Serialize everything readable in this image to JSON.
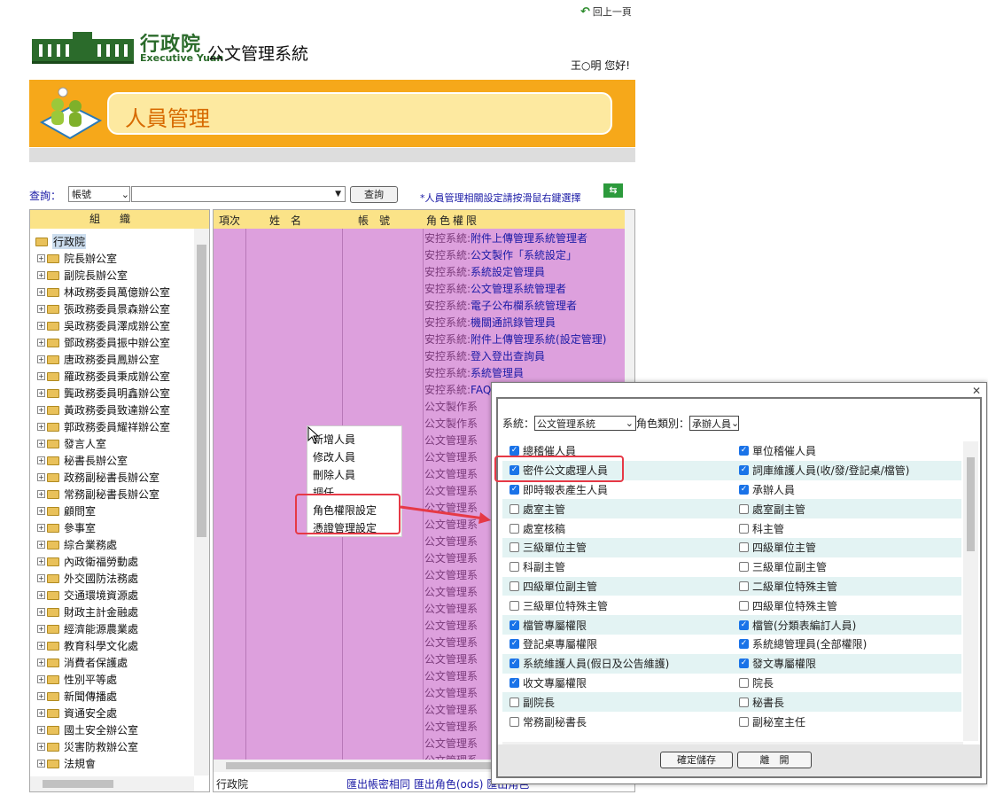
{
  "header": {
    "back_label": "回上一頁",
    "logo_cn": "行政院",
    "logo_en": "Executive Yuan",
    "system_name": "公文管理系統",
    "greeting": "王○明 您好!",
    "page_title": "人員管理"
  },
  "search": {
    "label": "查詢：",
    "field": "帳號",
    "button": "查詢",
    "hint": "*人員管理相關設定請按滑鼠右鍵選擇"
  },
  "org_panel": {
    "header": "組織",
    "root": "行政院",
    "items": [
      "院長辦公室",
      "副院長辦公室",
      "林政務委員萬億辦公室",
      "張政務委員景森辦公室",
      "吳政務委員澤成辦公室",
      "鄧政務委員振中辦公室",
      "唐政務委員鳳辦公室",
      "羅政務委員秉成辦公室",
      "龔政務委員明鑫辦公室",
      "黃政務委員致達辦公室",
      "郭政務委員耀祥辦公室",
      "發言人室",
      "秘書長辦公室",
      "政務副秘書長辦公室",
      "常務副秘書長辦公室",
      "顧問室",
      "參事室",
      "綜合業務處",
      "內政衛福勞動處",
      "外交國防法務處",
      "交通環境資源處",
      "財政主計金融處",
      "經濟能源農業處",
      "教育科學文化處",
      "消費者保護處",
      "性別平等處",
      "新聞傳播處",
      "資通安全處",
      "國土安全辦公室",
      "災害防救辦公室",
      "法規會"
    ]
  },
  "list": {
    "headers": {
      "no": "項次",
      "name": "姓　名",
      "account": "帳　號",
      "roles": "角色權限"
    },
    "roles": [
      {
        "sys": "安控系統:",
        "role": "附件上傳管理系統管理者"
      },
      {
        "sys": "安控系統:",
        "role": "公文製作「系統設定」"
      },
      {
        "sys": "安控系統:",
        "role": "系統設定管理員"
      },
      {
        "sys": "安控系統:",
        "role": "公文管理系統管理者"
      },
      {
        "sys": "安控系統:",
        "role": "電子公布欄系統管理者"
      },
      {
        "sys": "安控系統:",
        "role": "機關通訊錄管理員"
      },
      {
        "sys": "安控系統:",
        "role": "附件上傳管理系統(設定管理)"
      },
      {
        "sys": "安控系統:",
        "role": "登入登出查詢員"
      },
      {
        "sys": "安控系統:",
        "role": "系統管理員"
      },
      {
        "sys": "安控系統:",
        "role": "FAQ"
      },
      {
        "sys": "公文製作系",
        "role": ""
      },
      {
        "sys": "公文製作系",
        "role": ""
      },
      {
        "sys": "公文管理系",
        "role": ""
      },
      {
        "sys": "公文管理系",
        "role": ""
      },
      {
        "sys": "公文管理系",
        "role": ""
      },
      {
        "sys": "公文管理系",
        "role": ""
      },
      {
        "sys": "公文管理系",
        "role": ""
      },
      {
        "sys": "公文管理系",
        "role": ""
      },
      {
        "sys": "公文管理系",
        "role": ""
      },
      {
        "sys": "公文管理系",
        "role": ""
      },
      {
        "sys": "公文管理系",
        "role": ""
      },
      {
        "sys": "公文管理系",
        "role": ""
      },
      {
        "sys": "公文管理系",
        "role": ""
      },
      {
        "sys": "公文管理系",
        "role": ""
      },
      {
        "sys": "公文管理系",
        "role": ""
      },
      {
        "sys": "公文管理系",
        "role": ""
      },
      {
        "sys": "公文管理系",
        "role": ""
      },
      {
        "sys": "公文管理系",
        "role": ""
      },
      {
        "sys": "公文管理系",
        "role": ""
      },
      {
        "sys": "公文管理系",
        "role": ""
      },
      {
        "sys": "公文管理系",
        "role": ""
      },
      {
        "sys": "公文管理系",
        "role": ""
      }
    ],
    "footer_org": "行政院",
    "footer_export": "匯出帳密相同 匯出角色(ods) 匯出角色"
  },
  "context_menu": {
    "items": [
      "新增人員",
      "修改人員",
      "刪除人員",
      "調任",
      "角色權限設定",
      "憑證管理設定"
    ]
  },
  "dialog": {
    "system_label": "系統：",
    "system_value": "公文管理系統",
    "role_type_label": "角色類別：",
    "role_type_value": "承辦人員",
    "rows": [
      [
        {
          "label": "總稽催人員",
          "checked": true
        },
        {
          "label": "單位稽催人員",
          "checked": true
        }
      ],
      [
        {
          "label": "密件公文處理人員",
          "checked": true
        },
        {
          "label": "詞庫維護人員(收/發/登記桌/檔管)",
          "checked": true
        }
      ],
      [
        {
          "label": "即時報表產生人員",
          "checked": true
        },
        {
          "label": "承辦人員",
          "checked": true
        }
      ],
      [
        {
          "label": "處室主管",
          "checked": false
        },
        {
          "label": "處室副主管",
          "checked": false
        }
      ],
      [
        {
          "label": "處室核稿",
          "checked": false
        },
        {
          "label": "科主管",
          "checked": false
        }
      ],
      [
        {
          "label": "三級單位主管",
          "checked": false
        },
        {
          "label": "四級單位主管",
          "checked": false
        }
      ],
      [
        {
          "label": "科副主管",
          "checked": false
        },
        {
          "label": "三級單位副主管",
          "checked": false
        }
      ],
      [
        {
          "label": "四級單位副主管",
          "checked": false
        },
        {
          "label": "二級單位特殊主管",
          "checked": false
        }
      ],
      [
        {
          "label": "三級單位特殊主管",
          "checked": false
        },
        {
          "label": "四級單位特殊主管",
          "checked": false
        }
      ],
      [
        {
          "label": "檔管專屬權限",
          "checked": true
        },
        {
          "label": "檔管(分類表編訂人員)",
          "checked": true
        }
      ],
      [
        {
          "label": "登記桌專屬權限",
          "checked": true
        },
        {
          "label": "系統總管理員(全部權限)",
          "checked": true
        }
      ],
      [
        {
          "label": "系統維護人員(假日及公告維護)",
          "checked": true
        },
        {
          "label": "發文專屬權限",
          "checked": true
        }
      ],
      [
        {
          "label": "收文專屬權限",
          "checked": true
        },
        {
          "label": "院長",
          "checked": false
        }
      ],
      [
        {
          "label": "副院長",
          "checked": false
        },
        {
          "label": "秘書長",
          "checked": false
        }
      ],
      [
        {
          "label": "常務副秘書長",
          "checked": false
        },
        {
          "label": "副秘室主任",
          "checked": false
        }
      ]
    ],
    "confirm": "確定儲存",
    "leave": "離　開"
  }
}
